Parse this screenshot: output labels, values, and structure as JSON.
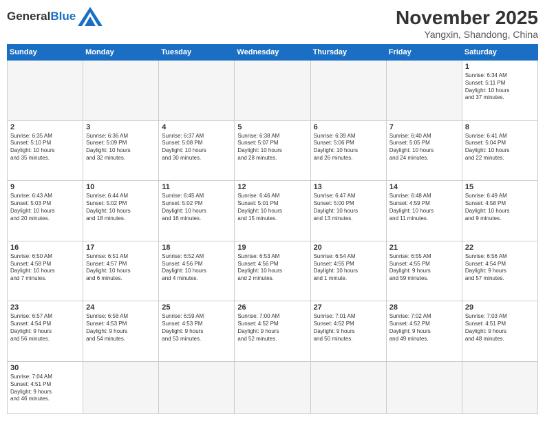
{
  "logo": {
    "text_general": "General",
    "text_blue": "Blue"
  },
  "header": {
    "month": "November 2025",
    "location": "Yangxin, Shandong, China"
  },
  "weekdays": [
    "Sunday",
    "Monday",
    "Tuesday",
    "Wednesday",
    "Thursday",
    "Friday",
    "Saturday"
  ],
  "days": {
    "d1": {
      "num": "1",
      "info": "Sunrise: 6:34 AM\nSunset: 5:11 PM\nDaylight: 10 hours\nand 37 minutes."
    },
    "d2": {
      "num": "2",
      "info": "Sunrise: 6:35 AM\nSunset: 5:10 PM\nDaylight: 10 hours\nand 35 minutes."
    },
    "d3": {
      "num": "3",
      "info": "Sunrise: 6:36 AM\nSunset: 5:09 PM\nDaylight: 10 hours\nand 32 minutes."
    },
    "d4": {
      "num": "4",
      "info": "Sunrise: 6:37 AM\nSunset: 5:08 PM\nDaylight: 10 hours\nand 30 minutes."
    },
    "d5": {
      "num": "5",
      "info": "Sunrise: 6:38 AM\nSunset: 5:07 PM\nDaylight: 10 hours\nand 28 minutes."
    },
    "d6": {
      "num": "6",
      "info": "Sunrise: 6:39 AM\nSunset: 5:06 PM\nDaylight: 10 hours\nand 26 minutes."
    },
    "d7": {
      "num": "7",
      "info": "Sunrise: 6:40 AM\nSunset: 5:05 PM\nDaylight: 10 hours\nand 24 minutes."
    },
    "d8": {
      "num": "8",
      "info": "Sunrise: 6:41 AM\nSunset: 5:04 PM\nDaylight: 10 hours\nand 22 minutes."
    },
    "d9": {
      "num": "9",
      "info": "Sunrise: 6:43 AM\nSunset: 5:03 PM\nDaylight: 10 hours\nand 20 minutes."
    },
    "d10": {
      "num": "10",
      "info": "Sunrise: 6:44 AM\nSunset: 5:02 PM\nDaylight: 10 hours\nand 18 minutes."
    },
    "d11": {
      "num": "11",
      "info": "Sunrise: 6:45 AM\nSunset: 5:02 PM\nDaylight: 10 hours\nand 16 minutes."
    },
    "d12": {
      "num": "12",
      "info": "Sunrise: 6:46 AM\nSunset: 5:01 PM\nDaylight: 10 hours\nand 15 minutes."
    },
    "d13": {
      "num": "13",
      "info": "Sunrise: 6:47 AM\nSunset: 5:00 PM\nDaylight: 10 hours\nand 13 minutes."
    },
    "d14": {
      "num": "14",
      "info": "Sunrise: 6:48 AM\nSunset: 4:59 PM\nDaylight: 10 hours\nand 11 minutes."
    },
    "d15": {
      "num": "15",
      "info": "Sunrise: 6:49 AM\nSunset: 4:58 PM\nDaylight: 10 hours\nand 9 minutes."
    },
    "d16": {
      "num": "16",
      "info": "Sunrise: 6:50 AM\nSunset: 4:58 PM\nDaylight: 10 hours\nand 7 minutes."
    },
    "d17": {
      "num": "17",
      "info": "Sunrise: 6:51 AM\nSunset: 4:57 PM\nDaylight: 10 hours\nand 6 minutes."
    },
    "d18": {
      "num": "18",
      "info": "Sunrise: 6:52 AM\nSunset: 4:56 PM\nDaylight: 10 hours\nand 4 minutes."
    },
    "d19": {
      "num": "19",
      "info": "Sunrise: 6:53 AM\nSunset: 4:56 PM\nDaylight: 10 hours\nand 2 minutes."
    },
    "d20": {
      "num": "20",
      "info": "Sunrise: 6:54 AM\nSunset: 4:55 PM\nDaylight: 10 hours\nand 1 minute."
    },
    "d21": {
      "num": "21",
      "info": "Sunrise: 6:55 AM\nSunset: 4:55 PM\nDaylight: 9 hours\nand 59 minutes."
    },
    "d22": {
      "num": "22",
      "info": "Sunrise: 6:56 AM\nSunset: 4:54 PM\nDaylight: 9 hours\nand 57 minutes."
    },
    "d23": {
      "num": "23",
      "info": "Sunrise: 6:57 AM\nSunset: 4:54 PM\nDaylight: 9 hours\nand 56 minutes."
    },
    "d24": {
      "num": "24",
      "info": "Sunrise: 6:58 AM\nSunset: 4:53 PM\nDaylight: 9 hours\nand 54 minutes."
    },
    "d25": {
      "num": "25",
      "info": "Sunrise: 6:59 AM\nSunset: 4:53 PM\nDaylight: 9 hours\nand 53 minutes."
    },
    "d26": {
      "num": "26",
      "info": "Sunrise: 7:00 AM\nSunset: 4:52 PM\nDaylight: 9 hours\nand 52 minutes."
    },
    "d27": {
      "num": "27",
      "info": "Sunrise: 7:01 AM\nSunset: 4:52 PM\nDaylight: 9 hours\nand 50 minutes."
    },
    "d28": {
      "num": "28",
      "info": "Sunrise: 7:02 AM\nSunset: 4:52 PM\nDaylight: 9 hours\nand 49 minutes."
    },
    "d29": {
      "num": "29",
      "info": "Sunrise: 7:03 AM\nSunset: 4:51 PM\nDaylight: 9 hours\nand 48 minutes."
    },
    "d30": {
      "num": "30",
      "info": "Sunrise: 7:04 AM\nSunset: 4:51 PM\nDaylight: 9 hours\nand 46 minutes."
    }
  }
}
